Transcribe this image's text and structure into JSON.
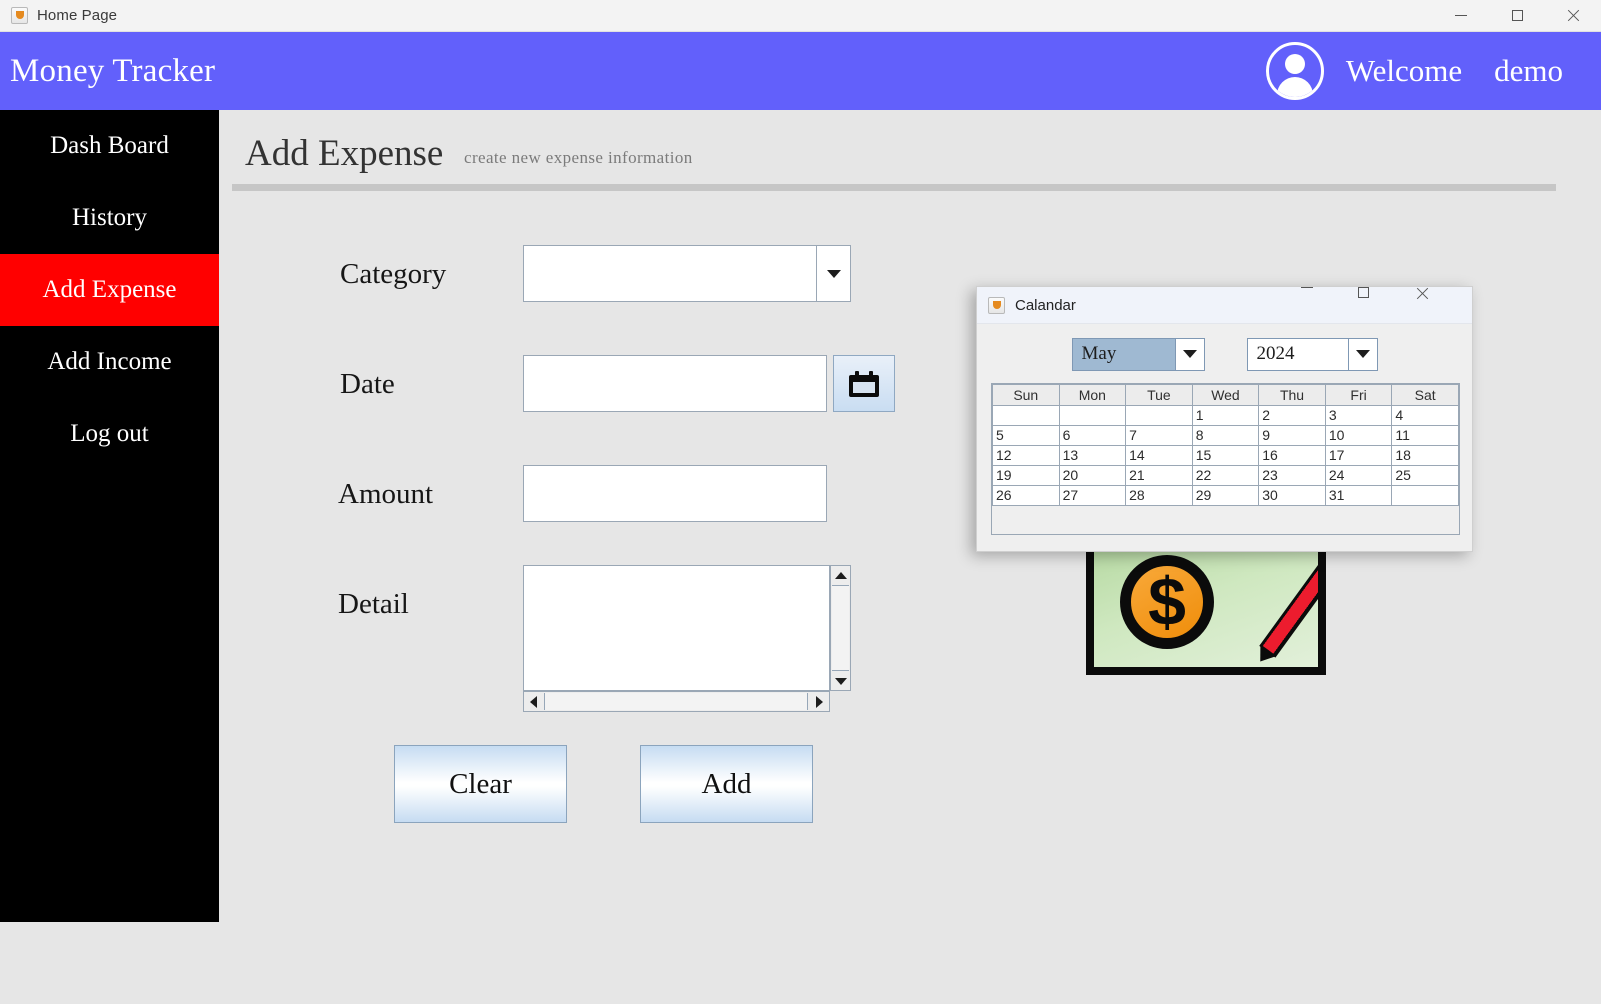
{
  "window": {
    "title": "Home Page",
    "icon": "java-icon",
    "controls": {
      "minimize": "minimize-icon",
      "maximize": "maximize-icon",
      "close": "close-icon"
    }
  },
  "header": {
    "brand": "Money Tracker",
    "welcome": "Welcome",
    "username": "demo",
    "avatar": "user-avatar-icon",
    "background_color": "#6260fb"
  },
  "sidebar": {
    "background_color": "#000000",
    "active_color": "#ff0000",
    "items": [
      {
        "label": "Dash Board",
        "active": false
      },
      {
        "label": "History",
        "active": false
      },
      {
        "label": "Add Expense",
        "active": true
      },
      {
        "label": "Add Income",
        "active": false
      },
      {
        "label": "Log out",
        "active": false
      }
    ]
  },
  "main": {
    "title": "Add Expense",
    "subtitle": "create new expense information",
    "fields": {
      "category": {
        "label": "Category",
        "value": "",
        "arrow": "chevron-down-icon"
      },
      "date": {
        "label": "Date",
        "value": "",
        "button_icon": "calendar-icon"
      },
      "amount": {
        "label": "Amount",
        "value": ""
      },
      "detail": {
        "label": "Detail",
        "value": ""
      }
    },
    "buttons": {
      "clear": "Clear",
      "add": "Add"
    },
    "image": {
      "name": "money-pencil-image",
      "symbol": "$"
    },
    "help": "?"
  },
  "calendar_dialog": {
    "title": "Calandar",
    "icon": "java-icon",
    "controls": {
      "minimize": "minimize-icon",
      "maximize": "maximize-icon",
      "close": "close-icon"
    },
    "month": "May",
    "year": "2024",
    "month_arrow": "chevron-down-icon",
    "year_arrow": "chevron-down-icon",
    "day_headers": [
      "Sun",
      "Mon",
      "Tue",
      "Wed",
      "Thu",
      "Fri",
      "Sat"
    ],
    "weeks": [
      [
        "",
        "",
        "",
        "1",
        "2",
        "3",
        "4"
      ],
      [
        "5",
        "6",
        "7",
        "8",
        "9",
        "10",
        "11"
      ],
      [
        "12",
        "13",
        "14",
        "15",
        "16",
        "17",
        "18"
      ],
      [
        "19",
        "20",
        "21",
        "22",
        "23",
        "24",
        "25"
      ],
      [
        "26",
        "27",
        "28",
        "29",
        "30",
        "31",
        ""
      ]
    ]
  }
}
